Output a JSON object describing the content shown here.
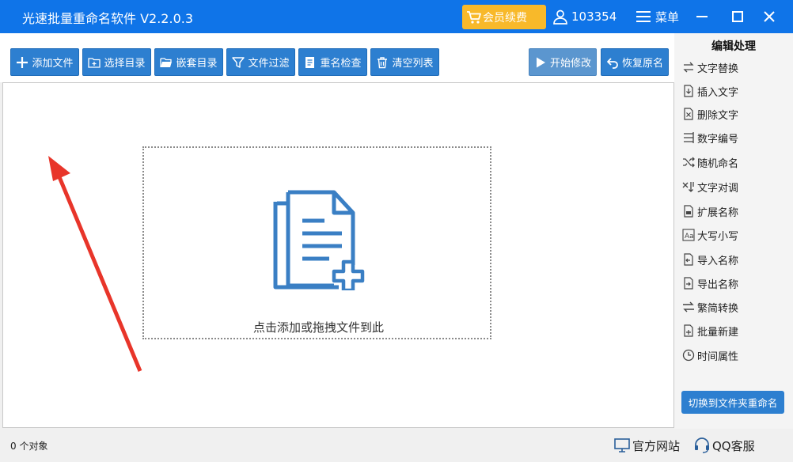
{
  "window": {
    "title": "光速批量重命名软件 V2.2.0.3",
    "vip_label": "会员续费",
    "user_id": "103354",
    "menu_label": "菜单"
  },
  "toolbar": {
    "add_file": "添加文件",
    "select_dir": "选择目录",
    "nested_dir": "嵌套目录",
    "file_filter": "文件过滤",
    "rename_check": "重名检查",
    "clear_list": "清空列表",
    "start_modify": "开始修改",
    "restore_name": "恢复原名"
  },
  "drop_zone": {
    "hint": "点击添加或拖拽文件到此"
  },
  "panel": {
    "title": "编辑处理",
    "items": [
      {
        "label": "文字替换",
        "icon": "replace-icon"
      },
      {
        "label": "插入文字",
        "icon": "insert-text-icon"
      },
      {
        "label": "删除文字",
        "icon": "delete-text-icon"
      },
      {
        "label": "数字编号",
        "icon": "number-list-icon"
      },
      {
        "label": "随机命名",
        "icon": "shuffle-icon"
      },
      {
        "label": "文字对调",
        "icon": "swap-text-icon"
      },
      {
        "label": "扩展名称",
        "icon": "extension-icon"
      },
      {
        "label": "大写小写",
        "icon": "letter-case-icon"
      },
      {
        "label": "导入名称",
        "icon": "import-icon"
      },
      {
        "label": "导出名称",
        "icon": "export-icon"
      },
      {
        "label": "繁简转换",
        "icon": "convert-icon"
      },
      {
        "label": "批量新建",
        "icon": "new-file-icon"
      },
      {
        "label": "时间属性",
        "icon": "clock-icon"
      }
    ],
    "switch_button": "切换到文件夹重命名"
  },
  "status": {
    "count": "0 个对象",
    "website": "官方网站",
    "qq_service": "QQ客服"
  },
  "colors": {
    "titlebar": "#0f74e8",
    "button": "#2d7fd0",
    "vip": "#f8b92a",
    "arrow": "#e8352a",
    "icon": "#3a7fc4"
  }
}
